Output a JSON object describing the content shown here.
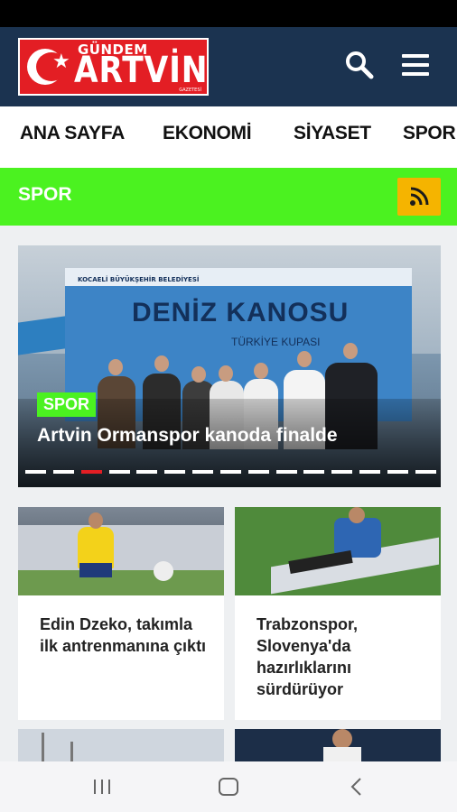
{
  "logo": {
    "top_text": "GÜNDEM",
    "main_text": "ARTVİN",
    "small_text": "GAZETESİ"
  },
  "header": {
    "search_icon": "search-icon",
    "menu_icon": "hamburger-menu-icon"
  },
  "nav": {
    "items": [
      "ANA SAYFA",
      "EKONOMİ",
      "SİYASET",
      "SPOR"
    ]
  },
  "category": {
    "title": "SPOR",
    "rss_icon": "rss-icon"
  },
  "slider": {
    "banner_strip": "KOCAELİ BÜYÜKŞEHİR BELEDİYESİ",
    "banner_title": "DENİZ KANOSU",
    "banner_subtitle": "TÜRKİYE KUPASI",
    "badge": "SPOR",
    "title": "Artvin Ormanspor kanoda finalde",
    "dot_count": 15,
    "active_dot": 3
  },
  "cards": [
    {
      "title": "Edin Dzeko, takımla ilk antrenmanına çıktı"
    },
    {
      "title": "Trabzonspor, Slovenya'da hazırlıklarını sürdürüyor"
    }
  ],
  "colors": {
    "header_bg": "#1b3350",
    "accent_green": "#4bf220",
    "rss_yellow": "#f5b400",
    "logo_red": "#e31e24"
  }
}
